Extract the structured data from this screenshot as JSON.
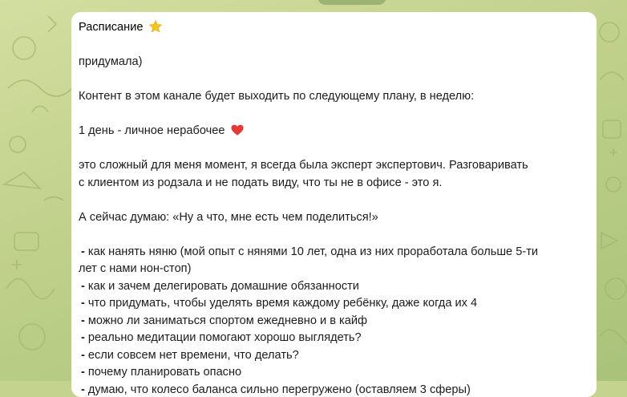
{
  "message": {
    "title": "Расписание",
    "title_icon": "star-icon",
    "intro": "придумала)",
    "plan_line": "Контент в этом канале будет выходить по следующему плану, в неделю:",
    "day1_heading": "1 день - личное нерабочее",
    "day1_icon": "heart-icon",
    "day1_text_line1": "это сложный для меня момент, я всегда была эксперт экспертович. Разговаривать",
    "day1_text_line2": "с клиентом из родзала и не подать виду, что ты не в офисе - это я.",
    "thinking_line": "А сейчас думаю: «Ну а что, мне есть чем поделиться!»",
    "list": [
      {
        "dash": "-",
        "text": "как нанять няню (мой опыт с нянями 10 лет, одна из них проработала больше 5-ти"
      },
      {
        "dash": "",
        "text": "лет с нами нон-стоп)"
      },
      {
        "dash": "-",
        "text": "как и зачем делегировать домашние обязанности"
      },
      {
        "dash": "-",
        "text": "что придумать, чтобы уделять время каждому ребёнку, даже когда их 4"
      },
      {
        "dash": "-",
        "text": "можно ли заниматься спортом ежедневно и в кайф"
      },
      {
        "dash": "-",
        "text": "реально медитации помогают хорошо выглядеть?"
      },
      {
        "dash": "-",
        "text": "если совсем нет времени, что делать?"
      },
      {
        "dash": "-",
        "text": "почему планировать опасно"
      },
      {
        "dash": "-",
        "text": "думаю, что колесо баланса сильно перегружено (оставляем 3 сферы)"
      }
    ]
  },
  "colors": {
    "background": "#c4d48f",
    "bubble": "#ffffff",
    "text": "#1c1c1c",
    "star": "#f5c518",
    "heart": "#e53935"
  }
}
